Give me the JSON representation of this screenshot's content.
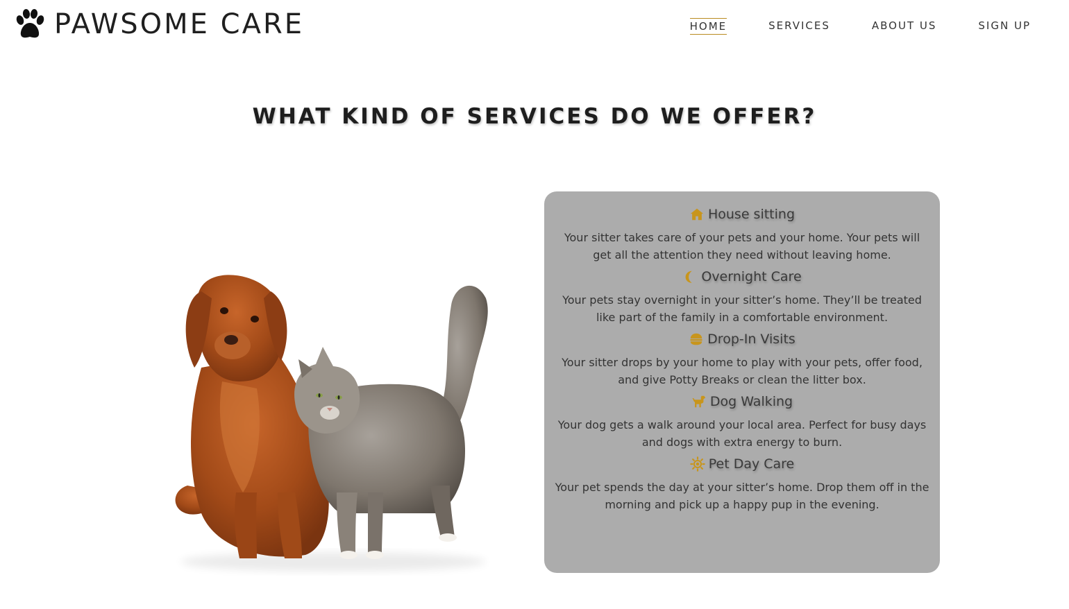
{
  "brand": {
    "name": "PAWSOME CARE",
    "logo_icon": "paw-icon"
  },
  "nav": {
    "items": [
      {
        "label": "HOME",
        "active": true
      },
      {
        "label": "SERVICES",
        "active": false
      },
      {
        "label": "ABOUT US",
        "active": false
      },
      {
        "label": "SIGN UP",
        "active": false
      }
    ]
  },
  "main": {
    "title": "WHAT KIND OF SERVICES DO WE OFFER?",
    "image": {
      "subject": "dog-and-cat-photo"
    },
    "services": [
      {
        "icon": "house-icon",
        "title": "House sitting",
        "description": "Your sitter takes care of your pets and your home. Your pets will get all the attention they need without leaving home."
      },
      {
        "icon": "moon-icon",
        "title": "Overnight Care",
        "description": "Your pets stay overnight in your sitter’s home. They’ll be treated like part of the family in a comfortable environment."
      },
      {
        "icon": "food-bowl-icon",
        "title": "Drop-In Visits",
        "description": "Your sitter drops by your home to play with your pets, offer food, and give Potty Breaks or clean the litter box."
      },
      {
        "icon": "dog-icon",
        "title": "Dog Walking",
        "description": "Your dog gets a walk around your local area. Perfect for busy days and dogs with extra energy to burn."
      },
      {
        "icon": "sun-icon",
        "title": "Pet Day Care",
        "description": "Your pet spends the day at your sitter’s home. Drop them off in the morning and pick up a happy pup in the evening."
      }
    ]
  },
  "colors": {
    "accent": "#c8951c",
    "card_bg": "#acacac",
    "text": "#333333"
  }
}
